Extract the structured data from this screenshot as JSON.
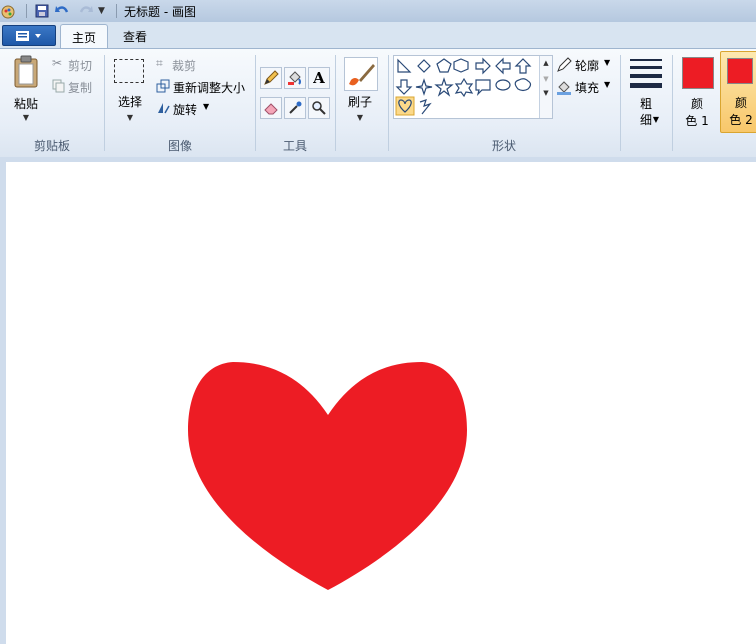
{
  "window": {
    "title": "无标题 - 画图"
  },
  "tabs": {
    "home": "主页",
    "view": "查看"
  },
  "clipboard": {
    "paste": "粘贴",
    "cut": "剪切",
    "copy": "复制",
    "group": "剪贴板"
  },
  "image": {
    "select": "选择",
    "crop": "裁剪",
    "resize": "重新调整大小",
    "rotate": "旋转",
    "group": "图像"
  },
  "tools": {
    "group": "工具"
  },
  "brushes": {
    "label": "刷子"
  },
  "shapes": {
    "outline": "轮廓",
    "fill": "填充",
    "group": "形状"
  },
  "size": {
    "label_line1": "粗",
    "label_line2": "细"
  },
  "colors": {
    "color1_line1": "颜",
    "color1_line2": "色 1",
    "color2_line1": "颜",
    "color2_line2": "色 2",
    "color1_value": "#ed1c24",
    "color2_value": "#ed1c24"
  },
  "drawing": {
    "shape": "heart",
    "fill_color": "#ed1c24"
  }
}
